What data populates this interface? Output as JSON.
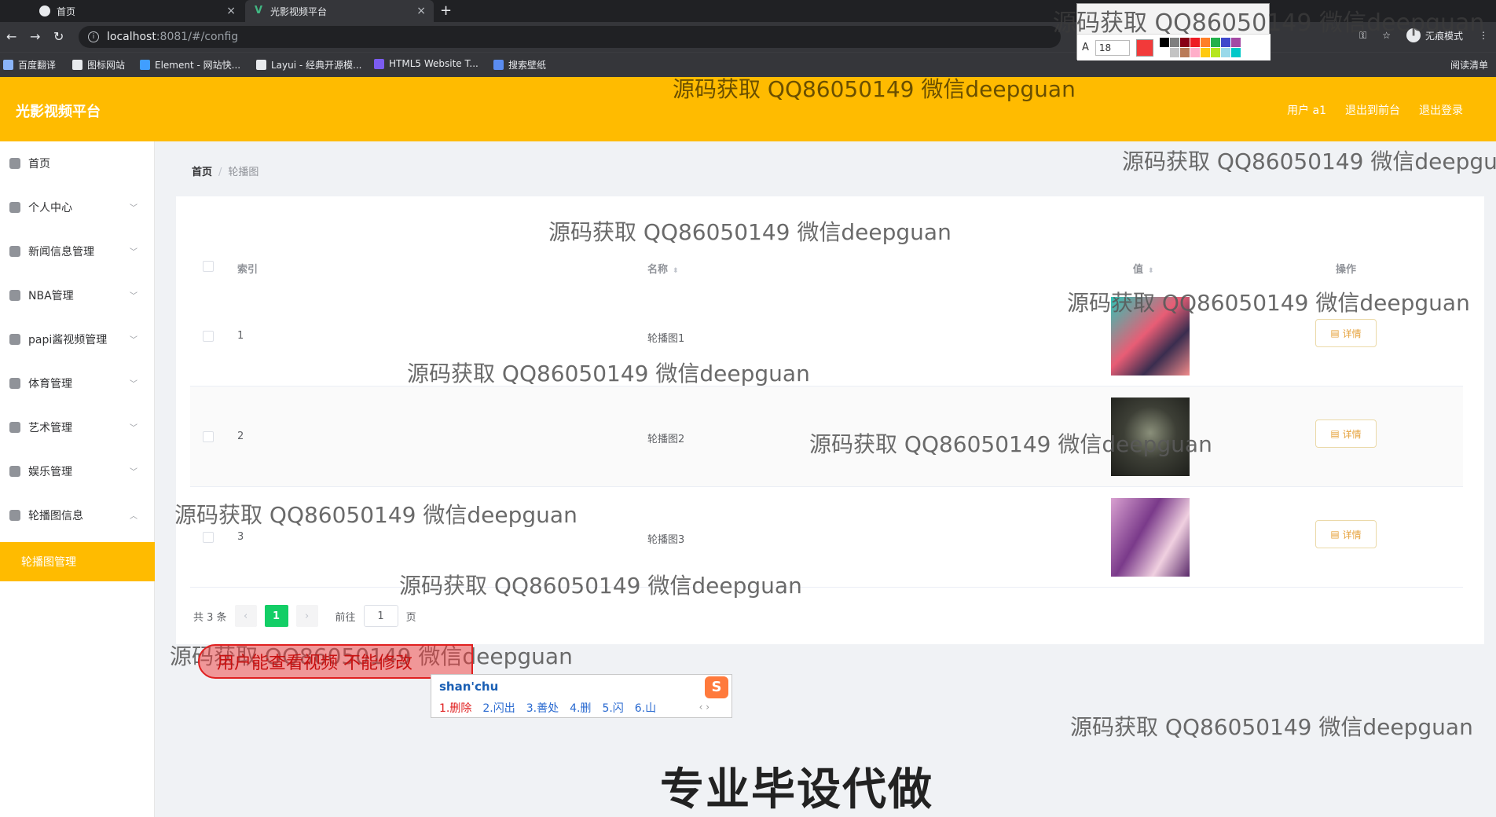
{
  "browser": {
    "tabs": [
      {
        "title": "首页",
        "close": "×"
      },
      {
        "title": "光影视频平台",
        "close": "×"
      }
    ],
    "new_tab": "+",
    "window_controls": [
      "—",
      "❐",
      "✕"
    ],
    "url_host": "localhost",
    "url_path": ":8081/#/config",
    "incognito_label": "无痕模式",
    "bookmarks": [
      "百度翻译",
      "图标网站",
      "Element - 网站快...",
      "Layui - 经典开源模...",
      "HTML5 Website T...",
      "搜索壁纸"
    ],
    "reading_list": "阅读清单"
  },
  "annotation_toolbar": {
    "font_icon": "A",
    "font_size": "18",
    "current_color": "#f23a3a",
    "palette": [
      "#000000",
      "#7f7f7f",
      "#880015",
      "#ed1c24",
      "#ff7f27",
      "#22b14c",
      "#3f48cc",
      "#a349a4",
      "#ffffff",
      "#c3c3c3",
      "#b97a57",
      "#ffaec9",
      "#ffc90e",
      "#b5e61d",
      "#99d9ea",
      "#00c8c8"
    ]
  },
  "header": {
    "brand": "光影视频平台",
    "user": "用户 a1",
    "back_to_front": "退出到前台",
    "logout": "退出登录"
  },
  "sidebar": {
    "items": [
      {
        "label": "首页",
        "icon": "home-icon",
        "expandable": false
      },
      {
        "label": "个人中心",
        "icon": "user-icon",
        "expandable": true
      },
      {
        "label": "新闻信息管理",
        "icon": "crop-icon",
        "expandable": true
      },
      {
        "label": "NBA管理",
        "icon": "mail-icon",
        "expandable": true
      },
      {
        "label": "papi酱视频管理",
        "icon": "monitor-icon",
        "expandable": true
      },
      {
        "label": "体育管理",
        "icon": "location-icon",
        "expandable": true
      },
      {
        "label": "艺术管理",
        "icon": "delete-icon",
        "expandable": true
      },
      {
        "label": "娱乐管理",
        "icon": "globe-icon",
        "expandable": true
      },
      {
        "label": "轮播图信息",
        "icon": "chart-icon",
        "expandable": true,
        "open": true
      }
    ],
    "active_sub": "轮播图管理"
  },
  "breadcrumb": {
    "home": "首页",
    "separator": "/",
    "current": "轮播图"
  },
  "table": {
    "headers": {
      "index": "索引",
      "name": "名称",
      "value": "值",
      "action": "操作"
    },
    "rows": [
      {
        "index": "1",
        "name": "轮播图1",
        "image": "carousel-image-1",
        "action": "详情"
      },
      {
        "index": "2",
        "name": "轮播图2",
        "image": "carousel-image-2",
        "action": "详情"
      },
      {
        "index": "3",
        "name": "轮播图3",
        "image": "carousel-image-3",
        "action": "详情"
      }
    ]
  },
  "pagination": {
    "total": "共 3 条",
    "prev": "‹",
    "current_page": "1",
    "next": "›",
    "goto_prefix": "前往",
    "goto_value": "1",
    "goto_suffix": "页"
  },
  "overlays": {
    "watermark": "源码获取 QQ86050149 微信deepguan",
    "red_annotation": "用户能查看视频 不能修改",
    "ime": {
      "pinyin": "shan'chu",
      "logo": "S",
      "candidates": [
        "1.删除",
        "2.闪出",
        "3.善处",
        "4.删",
        "5.闪",
        "6.山"
      ],
      "arrows": "‹ ›"
    },
    "promo": "专业毕设代做"
  }
}
